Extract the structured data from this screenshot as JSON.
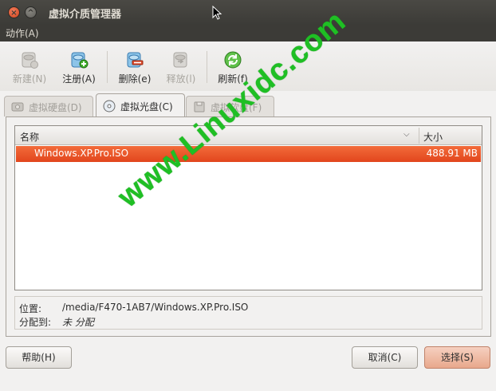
{
  "window": {
    "title": "虚拟介质管理器",
    "close_glyph": "×",
    "maximize_glyph": "^"
  },
  "menubar": {
    "action_label": "动作(A)"
  },
  "toolbar": {
    "new_label": "新建(N)",
    "register_label": "注册(A)",
    "delete_label": "删除(e)",
    "release_label": "释放(l)",
    "refresh_label": "刷新(f)"
  },
  "tabs": [
    {
      "label": "虚拟硬盘(D)",
      "active": false
    },
    {
      "label": "虚拟光盘(C)",
      "active": true
    },
    {
      "label": "虚拟软盘(F)",
      "active": false
    }
  ],
  "list": {
    "columns": {
      "name": "名称",
      "size": "大小",
      "sort_glyph": "⌵"
    },
    "rows": [
      {
        "name": "Windows.XP.Pro.ISO",
        "size": "488.91 MB",
        "selected": true
      }
    ]
  },
  "info": {
    "location_label": "位置:",
    "location_value": "/media/F470-1AB7/Windows.XP.Pro.ISO",
    "attached_label": "分配到:",
    "attached_value": "未 分配"
  },
  "buttons": {
    "help": "帮助(H)",
    "cancel": "取消(C)",
    "select": "选择(S)"
  },
  "watermark": "www.Linuxidc.com",
  "colors": {
    "selection": "#e2461d",
    "titlebar": "#3c3b37",
    "watermark": "#1fbf24"
  }
}
